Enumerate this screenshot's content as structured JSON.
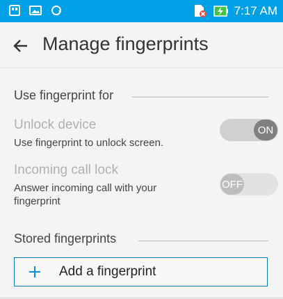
{
  "status_bar": {
    "time": "7:17 AM",
    "bg_color": "#00a0e6",
    "left_icons": [
      "sd-card-icon",
      "image-icon",
      "sync-icon"
    ],
    "right_icons": [
      "sim-off-icon",
      "battery-charging-icon"
    ]
  },
  "app_bar": {
    "title": "Manage fingerprints",
    "back_icon": "back-arrow-icon"
  },
  "sections": {
    "use_fingerprint_for": {
      "header": "Use fingerprint for",
      "unlock": {
        "title": "Unlock device",
        "subtitle": "Use fingerprint to unlock screen.",
        "toggle_label": "ON",
        "enabled": true
      },
      "incoming_call": {
        "title": "Incoming call lock",
        "subtitle": "Answer incoming call with your fingerprint",
        "toggle_label": "OFF",
        "enabled": false
      }
    },
    "stored_fingerprints": {
      "header": "Stored fingerprints",
      "add_button_label": "Add a fingerprint",
      "accent_color": "#0078b4"
    }
  }
}
